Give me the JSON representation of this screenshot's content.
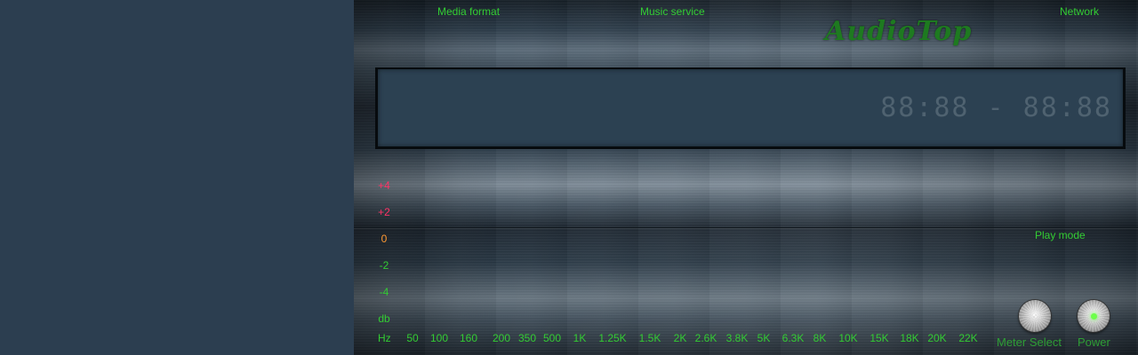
{
  "colors": {
    "green": "#33cc33",
    "red": "#ff3366",
    "orange": "#ff9933",
    "display_bg": "#2c4152",
    "panel_bg": "#2c3e50"
  },
  "nav": {
    "media_format": "Media format",
    "music_service": "Music service",
    "network": "Network"
  },
  "logo": "AudioTop",
  "display": {
    "time": "88:88 - 88:88"
  },
  "play_mode": "Play mode",
  "eq": {
    "db_labels": [
      {
        "text": "+4",
        "color": "#ff3366"
      },
      {
        "text": "+2",
        "color": "#ff3366"
      },
      {
        "text": "0",
        "color": "#ff9933"
      },
      {
        "text": "-2",
        "color": "#33cc33"
      },
      {
        "text": "-4",
        "color": "#33cc33"
      },
      {
        "text": "db",
        "color": "#33cc33"
      }
    ],
    "hz_label": "Hz",
    "frequencies": [
      "50",
      "100",
      "160",
      "200",
      "350",
      "500",
      "1K",
      "1.25K",
      "1.5K",
      "2K",
      "2.6K",
      "3.8K",
      "5K",
      "6.3K",
      "8K",
      "10K",
      "15K",
      "18K",
      "20K",
      "22K"
    ]
  },
  "controls": {
    "meter_select": {
      "label": "Meter Select",
      "icon": "knob-icon"
    },
    "power": {
      "label": "Power",
      "icon": "power-knob-icon",
      "led": "on"
    }
  }
}
